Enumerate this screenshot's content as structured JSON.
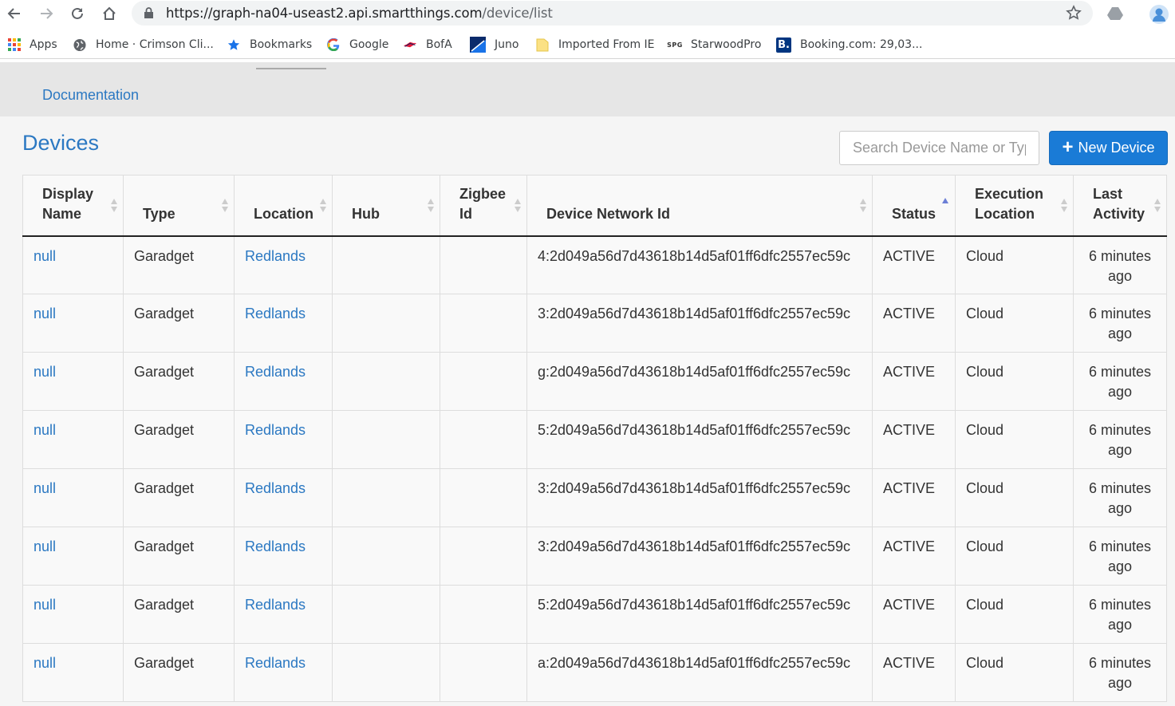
{
  "browser": {
    "url_host": "https://graph-na04-useast2.api.smartthings.com",
    "url_path": "/device/list",
    "bookmarks": [
      {
        "label": "Apps",
        "icon": "apps-grid-icon"
      },
      {
        "label": "Home · Crimson Cli...",
        "icon": "globe-icon"
      },
      {
        "label": "Bookmarks",
        "icon": "star-icon"
      },
      {
        "label": "Google",
        "icon": "google-icon"
      },
      {
        "label": "BofA",
        "icon": "bofa-flag-icon"
      },
      {
        "label": "Juno",
        "icon": "juno-icon"
      },
      {
        "label": "Imported From IE",
        "icon": "folder-icon"
      },
      {
        "label": "StarwoodPro",
        "icon": "spg-icon"
      },
      {
        "label": "Booking.com: 29,03...",
        "icon": "booking-icon"
      }
    ]
  },
  "nav": {
    "documentation_label": "Documentation"
  },
  "main": {
    "title": "Devices",
    "search_placeholder": "Search Device Name or Type",
    "new_device_label": "New Device"
  },
  "table": {
    "columns": [
      {
        "label": "Display Name"
      },
      {
        "label": "Type"
      },
      {
        "label": "Location"
      },
      {
        "label": "Hub"
      },
      {
        "label": "Zigbee Id"
      },
      {
        "label": "Device Network Id"
      },
      {
        "label": "Status",
        "sort": "asc"
      },
      {
        "label": "Execution Location"
      },
      {
        "label": "Last Activity"
      }
    ],
    "rows": [
      {
        "name": "null",
        "type": "Garadget",
        "location": "Redlands",
        "hub": "",
        "zigbee": "",
        "network_id": "4:2d049a56d7d43618b14d5af01ff6dfc2557ec59c",
        "status": "ACTIVE",
        "exec": "Cloud",
        "last": "6 minutes ago"
      },
      {
        "name": "null",
        "type": "Garadget",
        "location": "Redlands",
        "hub": "",
        "zigbee": "",
        "network_id": "3:2d049a56d7d43618b14d5af01ff6dfc2557ec59c",
        "status": "ACTIVE",
        "exec": "Cloud",
        "last": "6 minutes ago"
      },
      {
        "name": "null",
        "type": "Garadget",
        "location": "Redlands",
        "hub": "",
        "zigbee": "",
        "network_id": "g:2d049a56d7d43618b14d5af01ff6dfc2557ec59c",
        "status": "ACTIVE",
        "exec": "Cloud",
        "last": "6 minutes ago"
      },
      {
        "name": "null",
        "type": "Garadget",
        "location": "Redlands",
        "hub": "",
        "zigbee": "",
        "network_id": "5:2d049a56d7d43618b14d5af01ff6dfc2557ec59c",
        "status": "ACTIVE",
        "exec": "Cloud",
        "last": "6 minutes ago"
      },
      {
        "name": "null",
        "type": "Garadget",
        "location": "Redlands",
        "hub": "",
        "zigbee": "",
        "network_id": "3:2d049a56d7d43618b14d5af01ff6dfc2557ec59c",
        "status": "ACTIVE",
        "exec": "Cloud",
        "last": "6 minutes ago"
      },
      {
        "name": "null",
        "type": "Garadget",
        "location": "Redlands",
        "hub": "",
        "zigbee": "",
        "network_id": "3:2d049a56d7d43618b14d5af01ff6dfc2557ec59c",
        "status": "ACTIVE",
        "exec": "Cloud",
        "last": "6 minutes ago"
      },
      {
        "name": "null",
        "type": "Garadget",
        "location": "Redlands",
        "hub": "",
        "zigbee": "",
        "network_id": "5:2d049a56d7d43618b14d5af01ff6dfc2557ec59c",
        "status": "ACTIVE",
        "exec": "Cloud",
        "last": "6 minutes ago"
      },
      {
        "name": "null",
        "type": "Garadget",
        "location": "Redlands",
        "hub": "",
        "zigbee": "",
        "network_id": "a:2d049a56d7d43618b14d5af01ff6dfc2557ec59c",
        "status": "ACTIVE",
        "exec": "Cloud",
        "last": "6 minutes ago"
      }
    ]
  },
  "colors": {
    "accent": "#2b78c2",
    "button": "#1a7bd6"
  }
}
